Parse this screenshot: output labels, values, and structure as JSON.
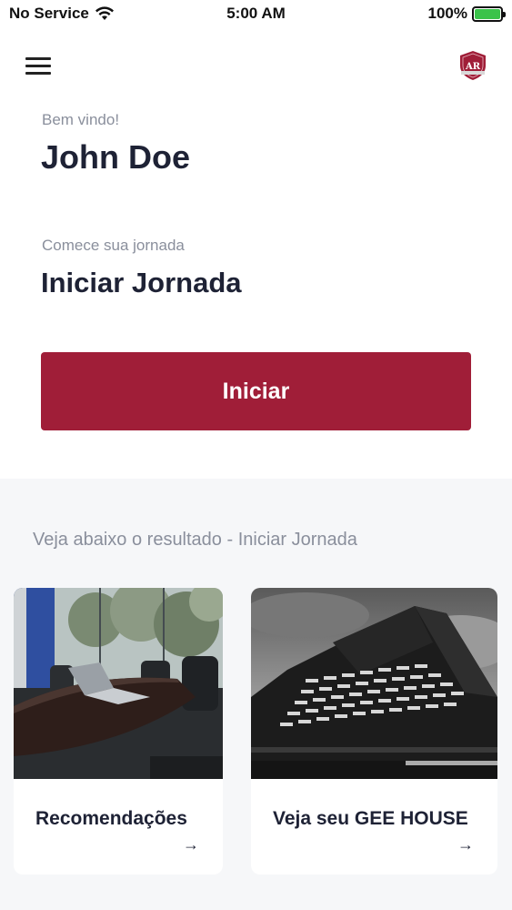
{
  "status_bar": {
    "carrier": "No Service",
    "time": "5:00 AM",
    "battery": "100%"
  },
  "header": {
    "menu_icon": "hamburger-menu-icon",
    "logo_icon": "shield-logo-icon",
    "logo_text": "AR"
  },
  "greeting": {
    "welcome": "Bem vindo!",
    "name": "John Doe"
  },
  "journey": {
    "label": "Comece sua jornada",
    "title": "Iniciar Jornada",
    "button_label": "Iniciar"
  },
  "results": {
    "heading": "Veja abaixo o resultado - Iniciar Jornada",
    "cards": [
      {
        "title": "Recomendações",
        "arrow": "→",
        "image": "meeting-room-photo"
      },
      {
        "title": "Veja seu GEE HOUSE",
        "arrow": "→",
        "image": "skyscraper-photo"
      }
    ]
  },
  "colors": {
    "accent": "#a01e38",
    "heading_text": "#1e2235",
    "muted_text": "#8a8f9c",
    "section_bg": "#f6f7f9"
  }
}
